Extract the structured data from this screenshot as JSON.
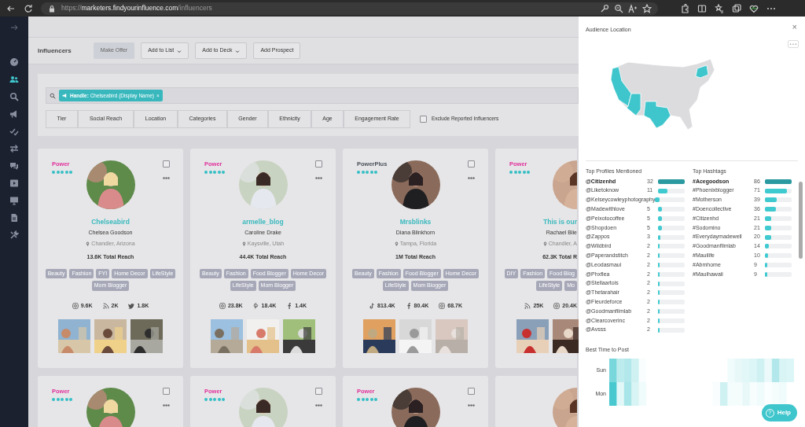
{
  "browser": {
    "url_scheme": "https://",
    "url_host": "marketers.findyourinfluence.com",
    "url_path": "/influencers"
  },
  "sidebar": {
    "items": [
      {
        "selected": false
      },
      {
        "selected": true
      },
      {
        "selected": false
      },
      {
        "selected": false
      },
      {
        "selected": false
      },
      {
        "selected": false
      },
      {
        "selected": false
      },
      {
        "selected": false
      },
      {
        "selected": false
      },
      {
        "selected": false
      },
      {
        "selected": false
      }
    ]
  },
  "toolbar": {
    "title": "Influencers",
    "buttons": [
      {
        "label": "Make Offer",
        "disabled": true,
        "dropdown": false
      },
      {
        "label": "Add to List",
        "disabled": false,
        "dropdown": true
      },
      {
        "label": "Add to Deck",
        "disabled": false,
        "dropdown": true
      },
      {
        "label": "Add Prospect",
        "disabled": false,
        "dropdown": false
      }
    ]
  },
  "search": {
    "chip": "**Handle:** Chelseabird (Display Name)",
    "chip_close": "×"
  },
  "filters": [
    "Tier",
    "Social Reach",
    "Location",
    "Categories",
    "Gender",
    "Ethnicity",
    "Age",
    "Engagement Rate"
  ],
  "exclude": {
    "label": "Exclude Reported Influencers",
    "checked": false
  },
  "cards": [
    {
      "cut": false,
      "tier": "Power",
      "color": "#e0309a",
      "stars": 5,
      "checked": false,
      "handle": "Chelseabird",
      "name": "Chelsea Goodson",
      "location": "Chandler, Arizona",
      "reach": "13.6K Total Reach",
      "tags": [
        "Beauty",
        "Fashion",
        "FYI",
        "Home Decor",
        "LifeStyle",
        "Mom Blogger"
      ],
      "stats": [
        {
          "kind": "instagram",
          "value": "9.6K"
        },
        {
          "kind": "rss",
          "value": "2K"
        },
        {
          "kind": "twitter",
          "value": "1.8K"
        }
      ]
    },
    {
      "cut": false,
      "tier": "Power",
      "color": "#e0309a",
      "stars": 5,
      "checked": false,
      "handle": "armelle_blog",
      "name": "Caroline Drake",
      "location": "Kaysville, Utah",
      "reach": "44.4K Total Reach",
      "tags": [
        "Beauty",
        "Fashion",
        "Food Blogger",
        "Home Decor",
        "LifeStyle",
        "Mom Blogger"
      ],
      "stats": [
        {
          "kind": "instagram",
          "value": "23.8K"
        },
        {
          "kind": "pinterest",
          "value": "18.4K"
        },
        {
          "kind": "facebook",
          "value": "1.4K"
        }
      ]
    },
    {
      "cut": false,
      "tier": "PowerPlus",
      "color": "#4a4f5a",
      "stars": 5,
      "checked": false,
      "handle": "Mrsblinks",
      "name": "Diana Blinkhorn",
      "location": "Tampa, Florida",
      "reach": "1M Total Reach",
      "tags": [
        "Beauty",
        "Fashion",
        "Food Blogger",
        "Home Decor",
        "LifeStyle",
        "Mom Blogger"
      ],
      "stats": [
        {
          "kind": "tiktok",
          "value": "813.4K"
        },
        {
          "kind": "facebook",
          "value": "80.4K"
        },
        {
          "kind": "instagram",
          "value": "68.7K"
        }
      ]
    },
    {
      "cut": true,
      "tier": "Power",
      "color": "#e0309a",
      "stars": 5,
      "handle": "This is our",
      "name": "Rachael Blie",
      "location": "Chandler, A",
      "reach": "62.3K Total R",
      "tags": [
        "DIY",
        "Fashion",
        "Food Blog",
        "LifeStyle",
        "Mo"
      ],
      "stats": [
        {
          "kind": "rss",
          "value": "25K"
        },
        {
          "kind": "instagram",
          "value": "20.4K"
        }
      ]
    }
  ],
  "cards_row2": [
    {
      "cut": false,
      "tier": "Power",
      "color": "#e0309a",
      "stars": 5,
      "checked": false
    },
    {
      "cut": false,
      "tier": "Power",
      "color": "#e0309a",
      "stars": 5,
      "checked": false
    },
    {
      "cut": false,
      "tier": "Power",
      "color": "#e0309a",
      "stars": 5,
      "checked": false
    },
    {
      "cut": true
    }
  ],
  "panel": {
    "close": "×",
    "audience_title": "Audience Location",
    "profiles_title": "Top Profiles Mentioned",
    "profiles": [
      {
        "label": "@Citizenhd",
        "count": "32",
        "level": 1,
        "top": true
      },
      {
        "label": "@Liketoknow",
        "count": "11",
        "level": 0.34,
        "top": false
      },
      {
        "label": "@Kelseycowleyphotography",
        "level": 0.16,
        "top": false
      },
      {
        "label": "@Madewithlove",
        "count": "5",
        "level": 0.16,
        "top": false
      },
      {
        "label": "@Peixotocoffee",
        "count": "5",
        "level": 0.16,
        "top": false
      },
      {
        "label": "@Shopdoen",
        "count": "5",
        "level": 0.16,
        "top": false
      },
      {
        "label": "@Zappos",
        "count": "3",
        "level": 0.09,
        "top": false
      },
      {
        "label": "@Wildbird",
        "count": "2",
        "level": 0.06,
        "top": false
      },
      {
        "label": "@Paperandstitch",
        "count": "2",
        "level": 0.06,
        "top": false
      },
      {
        "label": "@Leodasmaui",
        "count": "2",
        "level": 0.06,
        "top": false
      },
      {
        "label": "@Phxflea",
        "count": "2",
        "level": 0.06,
        "top": false
      },
      {
        "label": "@Stellaartois",
        "count": "2",
        "level": 0.06,
        "top": false
      },
      {
        "label": "@Thetarahair",
        "count": "2",
        "level": 0.06,
        "top": false
      },
      {
        "label": "@Fleurdeforce",
        "count": "2",
        "level": 0.06,
        "top": false
      },
      {
        "label": "@Goodmanfilmlab",
        "count": "2",
        "level": 0.06,
        "top": false
      },
      {
        "label": "@Clearcoverinc",
        "count": "2",
        "level": 0.06,
        "top": false
      },
      {
        "label": "@Avsss",
        "count": "2",
        "level": 0.06,
        "top": false
      }
    ],
    "hashtags_title": "Top Hashtags",
    "hashtags": [
      {
        "label": "#Acegoodson",
        "count": "86",
        "level": 1,
        "top": true
      },
      {
        "label": "#Phoenixblogger",
        "count": "71",
        "level": 0.83,
        "top": false
      },
      {
        "label": "#Motherson",
        "count": "39",
        "level": 0.45,
        "top": false
      },
      {
        "label": "#Doencollective",
        "count": "36",
        "level": 0.42,
        "top": false
      },
      {
        "label": "#Citizenhd",
        "count": "21",
        "level": 0.24,
        "top": false
      },
      {
        "label": "#Sodomino",
        "count": "21",
        "level": 0.24,
        "top": false
      },
      {
        "label": "#Everydaymadewell",
        "count": "20",
        "level": 0.23,
        "top": false
      },
      {
        "label": "#Goodmanfilmlab",
        "count": "14",
        "level": 0.16,
        "top": false
      },
      {
        "label": "#Mauilife",
        "count": "10",
        "level": 0.12,
        "top": false
      },
      {
        "label": "#Abmhome",
        "count": "9",
        "level": 0.1,
        "top": false
      },
      {
        "label": "#Mauihawaii",
        "count": "9",
        "level": 0.1,
        "top": false
      }
    ],
    "best_time_title": "Best Time to Post",
    "days": [
      "Sun",
      "Mon"
    ],
    "help": "Help",
    "help_icon": "?"
  }
}
